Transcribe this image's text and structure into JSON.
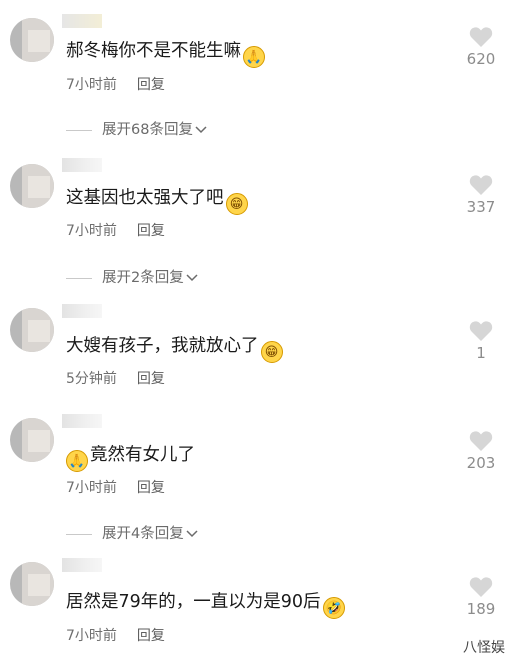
{
  "comments": [
    {
      "text": "郝冬梅你不是不能生嘛",
      "emoji": "🙏",
      "time": "7小时前",
      "reply": "回复",
      "likes": "620",
      "expand": "展开68条回复"
    },
    {
      "text": "这基因也太强大了吧",
      "emoji": "😁",
      "time": "7小时前",
      "reply": "回复",
      "likes": "337",
      "expand": "展开2条回复"
    },
    {
      "text": "大嫂有孩子，我就放心了",
      "emoji": "😁",
      "time": "5分钟前",
      "reply": "回复",
      "likes": "1"
    },
    {
      "pre_emoji": "🙏",
      "text": "竟然有女儿了",
      "time": "7小时前",
      "reply": "回复",
      "likes": "203",
      "expand": "展开4条回复"
    },
    {
      "text": "居然是79年的，一直以为是90后",
      "emoji": "🤣",
      "time": "7小时前",
      "reply": "回复",
      "likes": "189"
    }
  ],
  "watermark": "八怪娱"
}
